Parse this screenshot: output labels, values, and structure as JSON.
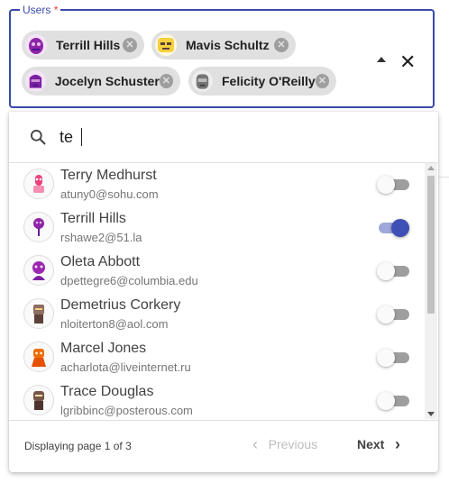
{
  "field": {
    "label": "Users",
    "required_mark": "*",
    "accent_color": "#3949ab",
    "required_color": "#e53935"
  },
  "chips": [
    {
      "name": "Terrill Hills",
      "avatar_color": "#8e24aa",
      "remove_icon": "cancel-circle-icon"
    },
    {
      "name": "Mavis Schultz",
      "avatar_color": "#f4d03f",
      "remove_icon": "cancel-circle-icon"
    },
    {
      "name": "Jocelyn Schuster",
      "avatar_color": "#7b1fa2",
      "remove_icon": "cancel-circle-icon"
    },
    {
      "name": "Felicity O'Reilly",
      "avatar_color": "#757575",
      "remove_icon": "cancel-circle-icon"
    }
  ],
  "controls": {
    "collapse_icon": "caret-up-icon",
    "clear_icon": "close-icon",
    "clear_glyph": "✕"
  },
  "search": {
    "value": "te",
    "icon": "search-icon"
  },
  "options": [
    {
      "name": "Terry Medhurst",
      "email": "atuny0@sohu.com",
      "selected": false,
      "avatar_color": "#ec407a"
    },
    {
      "name": "Terrill Hills",
      "email": "rshawe2@51.la",
      "selected": true,
      "avatar_color": "#8e24aa"
    },
    {
      "name": "Oleta Abbott",
      "email": "dpettegre6@columbia.edu",
      "selected": false,
      "avatar_color": "#9c27b0"
    },
    {
      "name": "Demetrius Corkery",
      "email": "nloiterton8@aol.com",
      "selected": false,
      "avatar_color": "#8d6e63"
    },
    {
      "name": "Marcel Jones",
      "email": "acharlota@liveinternet.ru",
      "selected": false,
      "avatar_color": "#ef6c00"
    },
    {
      "name": "Trace Douglas",
      "email": "lgribbinc@posterous.com",
      "selected": false,
      "avatar_color": "#795548"
    }
  ],
  "footer": {
    "page_info": "Displaying page 1 of 3",
    "prev_label": "Previous",
    "next_label": "Next",
    "prev_glyph": "‹",
    "next_glyph": "›"
  },
  "toggle_colors": {
    "on_thumb": "#3f51b5",
    "on_track": "#9fa8da",
    "off_track": "#9e9e9e"
  }
}
